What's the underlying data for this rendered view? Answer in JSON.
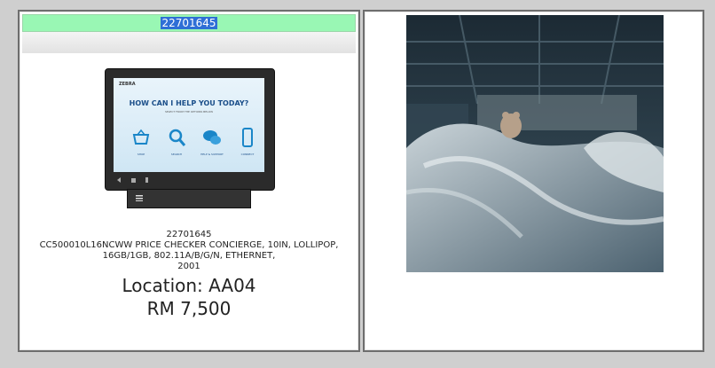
{
  "left_panel": {
    "barcode_field": "22701645",
    "product": {
      "code": "22701645",
      "description_line1": "CC500010L16NCWW PRICE CHECKER CONCIERGE, 10IN, LOLLIPOP,",
      "description_line2": "16GB/1GB, 802.11A/B/G/N, ETHERNET,",
      "description_line3": "2001",
      "location": "Location: AA04",
      "price": "RM 7,500"
    },
    "device_screen": {
      "brand": "ZEBRA",
      "headline": "HOW CAN I HELP YOU TODAY?",
      "sub": "SELECT FROM THE OPTIONS BELOW",
      "icons": [
        {
          "name": "basket-icon",
          "label": "SHOP"
        },
        {
          "name": "search-icon",
          "label": "SEARCH"
        },
        {
          "name": "chat-icon",
          "label": "HELP & SUPPORT"
        },
        {
          "name": "phone-icon",
          "label": "CONNECT"
        }
      ]
    }
  },
  "colors": {
    "barcode_bg": "#99f7b4",
    "selection": "#2f6fd6",
    "panel_border": "#6e6e6e",
    "background": "#cfcfcf"
  }
}
